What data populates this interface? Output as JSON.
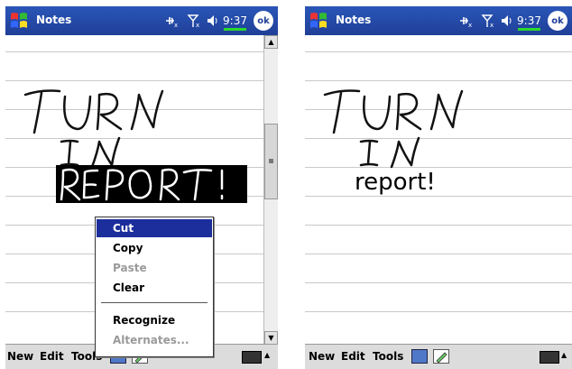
{
  "screens": [
    {
      "title": "Notes",
      "clock": "9:37",
      "ok_label": "ok",
      "ink_text": "TURN IN REPORT!",
      "selection_color": "#000000",
      "context_menu": {
        "items": [
          "Cut",
          "Copy",
          "Paste",
          "Clear",
          "Recognize",
          "Alternates..."
        ],
        "selected": "Cut",
        "disabled": [
          "Paste",
          "Alternates..."
        ]
      },
      "menubar": {
        "new": "New",
        "edit": "Edit",
        "tools": "Tools"
      }
    },
    {
      "title": "Notes",
      "clock": "9:37",
      "ok_label": "ok",
      "ink_text": "TURN IN",
      "typed_text": "report!",
      "menubar": {
        "new": "New",
        "edit": "Edit",
        "tools": "Tools"
      }
    }
  ],
  "colors": {
    "titlebar": "#1f3f98",
    "menu_highlight": "#1c2e9b",
    "menubar_bg": "#dcdcdc"
  }
}
